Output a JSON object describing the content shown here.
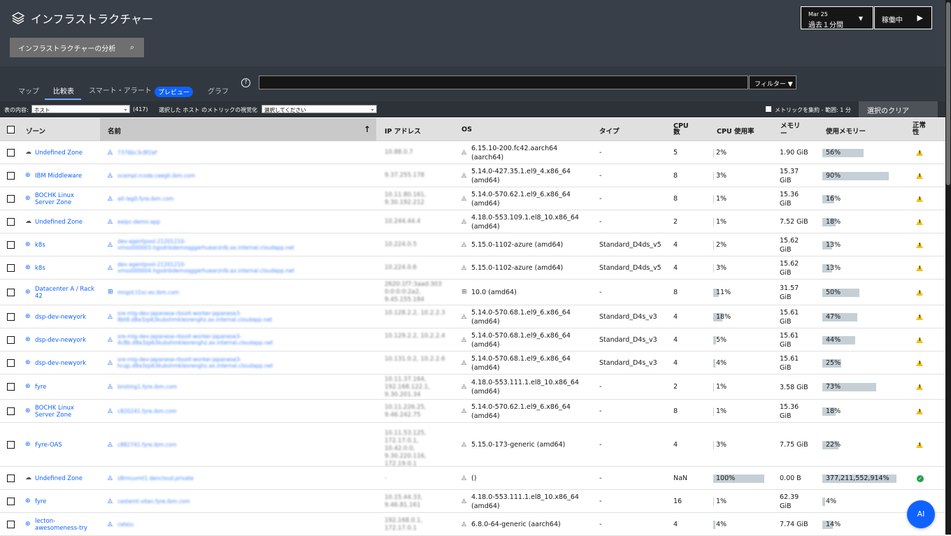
{
  "header": {
    "title": "インフラストラクチャー",
    "time_date": "Mar 25",
    "time_range": "過去１分間",
    "run_label": "稼働中",
    "analyze_label": "インフラストラクチャーの分析"
  },
  "tabs": [
    {
      "label": "マップ",
      "active": false
    },
    {
      "label": "比較表",
      "active": true
    },
    {
      "label": "スマート・アラート",
      "active": false
    },
    {
      "label": "グラフ",
      "active": false
    }
  ],
  "preview_badge": "プレビュー",
  "filter_label": "フィルター",
  "controls": {
    "table_content_label": "表の内容:",
    "table_content_value": "ホスト",
    "count": "(417)",
    "visualize_label": "選択した ホスト のメトリックの視覚化",
    "visualize_value": "選択してください",
    "aggregate_label": "メトリックを集約 - 範囲: 1 分",
    "clear_label": "選択のクリア"
  },
  "columns": [
    "ゾーン",
    "名前",
    "IP アドレス",
    "OS",
    "タイプ",
    "CPU 数",
    "CPU 使用率",
    "メモリー",
    "使用メモリー",
    "正常性"
  ],
  "rows": [
    {
      "zone": "Undefined Zone",
      "zone_icon": "cloud-icon",
      "name": "7376bc3c8f2ef",
      "ip": "10.88.0.7",
      "os": "6.15.10-200.fc42.aarch64 (aarch64)",
      "os_icon": "linux-icon",
      "type": "-",
      "cpus": "5",
      "cpu": "2%",
      "cpu_frac": 0.02,
      "mem": "1.90 GiB",
      "memused": "56%",
      "mem_frac": 0.56,
      "health": "warning"
    },
    {
      "zone": "IBM Middleware",
      "zone_icon": "zone-icon",
      "name": "ocempl.rcode.ceegh.ibm.com",
      "ip": "9.37.255.178",
      "os": "5.14.0-427.35.1.el9_4.x86_64 (amd64)",
      "os_icon": "linux-icon",
      "type": "-",
      "cpus": "8",
      "cpu": "3%",
      "cpu_frac": 0.03,
      "mem": "15.37 GiB",
      "memused": "90%",
      "mem_frac": 0.9,
      "health": "warning"
    },
    {
      "zone": "BOCHK Linux Server Zone",
      "zone_icon": "zone-icon",
      "name": "ait-lag0.fyre.ibm.com",
      "ip": "10.11.80.161, 9.30.192.212",
      "os": "5.14.0-570.62.1.el9_6.x86_64 (amd64)",
      "os_icon": "linux-icon",
      "type": "-",
      "cpus": "8",
      "cpu": "1%",
      "cpu_frac": 0.01,
      "mem": "15.36 GiB",
      "memused": "16%",
      "mem_frac": 0.16,
      "health": "warning"
    },
    {
      "zone": "Undefined Zone",
      "zone_icon": "cloud-icon",
      "name": "eaipc-demo-app",
      "ip": "10.244.44.4",
      "os": "4.18.0-553.109.1.el8_10.x86_64 (amd64)",
      "os_icon": "linux-icon",
      "type": "-",
      "cpus": "2",
      "cpu": "1%",
      "cpu_frac": 0.01,
      "mem": "7.52 GiB",
      "memused": "18%",
      "mem_frac": 0.18,
      "health": "warning"
    },
    {
      "zone": "k8s",
      "zone_icon": "zone-icon",
      "name": "dev-agentpool-21201210-vmss000003.hgsdnbdemoqggerhuearznlb.ax.internal.cloudapp.net",
      "ip": "10.224.0.5",
      "os": "5.15.0-1102-azure (amd64)",
      "os_icon": "linux-icon",
      "type": "Standard_D4ds_v5",
      "cpus": "4",
      "cpu": "2%",
      "cpu_frac": 0.02,
      "mem": "15.62 GiB",
      "memused": "13%",
      "mem_frac": 0.13,
      "health": "warning"
    },
    {
      "zone": "k8s",
      "zone_icon": "zone-icon",
      "name": "dev-agentpool-21201210-vmss000004.hgsdnbdemoqggerhuearznlb.ax.internal.cloudapp.net",
      "ip": "10.224.0.6",
      "os": "5.15.0-1102-azure (amd64)",
      "os_icon": "linux-icon",
      "type": "Standard_D4ds_v5",
      "cpus": "4",
      "cpu": "3%",
      "cpu_frac": 0.03,
      "mem": "15.62 GiB",
      "memused": "13%",
      "mem_frac": 0.13,
      "health": "warning"
    },
    {
      "zone": "Datacenter A / Rack 42",
      "zone_icon": "zone-icon",
      "name": "mngst.t1sc-es.ibm.com",
      "ip": "2620:1f7:3aad:303 0:0:0:0:2a2, 9.45.155.184",
      "os": "10.0 (amd64)",
      "os_icon": "windows-icon",
      "type": "-",
      "cpus": "8",
      "cpu": "11%",
      "cpu_frac": 0.11,
      "mem": "31.57 GiB",
      "memused": "50%",
      "mem_frac": 0.5,
      "health": "warning"
    },
    {
      "zone": "dsp-dev-newyork",
      "zone_icon": "zone-icon",
      "name": "sre-mlg-dev-japanese-rbsoit-worker-japanese3-8bt8.d8a3zp63kubshmklesrenghz.ax.internal.cloudapp.net",
      "ip": "10.128.2.2, 10.2.2.3",
      "os": "5.14.0-570.68.1.el9_6.x86_64 (amd64)",
      "os_icon": "linux-icon",
      "type": "Standard_D4s_v3",
      "cpus": "4",
      "cpu": "18%",
      "cpu_frac": 0.18,
      "mem": "15.61 GiB",
      "memused": "47%",
      "mem_frac": 0.47,
      "health": "warning"
    },
    {
      "zone": "dsp-dev-newyork",
      "zone_icon": "zone-icon",
      "name": "sre-mlg-dev-japanese-rbsoit-worker-japanese3-4c8b.d8a3zp63kubshmklesrenghz.ax.internal.cloudapp.net",
      "ip": "10.129.2.2, 10.2.2.4",
      "os": "5.14.0-570.68.1.el9_6.x86_64 (amd64)",
      "os_icon": "linux-icon",
      "type": "Standard_D4s_v3",
      "cpus": "4",
      "cpu": "5%",
      "cpu_frac": 0.05,
      "mem": "15.61 GiB",
      "memused": "44%",
      "mem_frac": 0.44,
      "health": "warning"
    },
    {
      "zone": "dsp-dev-newyork",
      "zone_icon": "zone-icon",
      "name": "sre-mlg-dev-japanese-rbsoit-worker-japanese3-hcqp.d8a3zp63kubshmklesrenghz.ax.internal.cloudapp.net",
      "ip": "10.131.0.2, 10.2.2.6",
      "os": "5.14.0-570.68.1.el9_6.x86_64 (amd64)",
      "os_icon": "linux-icon",
      "type": "Standard_D4s_v3",
      "cpus": "4",
      "cpu": "4%",
      "cpu_frac": 0.04,
      "mem": "15.61 GiB",
      "memused": "25%",
      "mem_frac": 0.25,
      "health": "warning"
    },
    {
      "zone": "fyre",
      "zone_icon": "zone-icon",
      "name": "bnstmg1.fyre.ibm.com",
      "ip": "10.11.37.164, 192.168.122.1, 9.30.201.34",
      "os": "4.18.0-553.111.1.el8_10.x86_64 (amd64)",
      "os_icon": "linux-icon",
      "type": "-",
      "cpus": "2",
      "cpu": "1%",
      "cpu_frac": 0.01,
      "mem": "3.58 GiB",
      "memused": "73%",
      "mem_frac": 0.73,
      "health": "warning"
    },
    {
      "zone": "BOCHK Linux Server Zone",
      "zone_icon": "zone-icon",
      "name": "c820241.fyre.ibm.com",
      "ip": "10.11.226.25, 9.46.242.75",
      "os": "5.14.0-570.62.1.el9_6.x86_64 (amd64)",
      "os_icon": "linux-icon",
      "type": "-",
      "cpus": "8",
      "cpu": "1%",
      "cpu_frac": 0.01,
      "mem": "15.36 GiB",
      "memused": "18%",
      "mem_frac": 0.18,
      "health": "warning"
    },
    {
      "zone": "Fyre-OAS",
      "zone_icon": "zone-icon",
      "name": "c882741.fyre.ibm.com",
      "ip": "10.11.53.125, 172.17.0.1, 10.42.0.0, 9.30.220.116, 172.19.0.1",
      "os": "5.15.0-173-generic (amd64)",
      "os_icon": "linux-icon",
      "type": "-",
      "cpus": "4",
      "cpu": "3%",
      "cpu_frac": 0.03,
      "mem": "7.75 GiB",
      "memused": "22%",
      "mem_frac": 0.22,
      "health": "warning"
    },
    {
      "zone": "Undefined Zone",
      "zone_icon": "cloud-icon",
      "name": "s8rmuvmt1.dencloud.private",
      "ip": "-",
      "os": "()",
      "os_icon": "linux-icon",
      "type": "-",
      "cpus": "NaN",
      "cpu": "100%",
      "cpu_frac": 1.0,
      "mem": "0.00 B",
      "memused": "377,211,552,914%",
      "mem_frac": 1.0,
      "health": "ok"
    },
    {
      "zone": "fyre",
      "zone_icon": "zone-icon",
      "name": "cestemt-vitan.fyre.ibm.com",
      "ip": "10.15.44.33, 9.46.81.161",
      "os": "4.18.0-553.111.1.el8_10.x86_64 (amd64)",
      "os_icon": "linux-icon",
      "type": "-",
      "cpus": "16",
      "cpu": "1%",
      "cpu_frac": 0.01,
      "mem": "62.39 GiB",
      "memused": "4%",
      "mem_frac": 0.04,
      "health": "none"
    },
    {
      "zone": "lecton-awesomeness-try",
      "zone_icon": "zone-icon",
      "name": "ceteiu",
      "ip": "192.168.0.1, 172.17.0.1",
      "os": "6.8.0-64-generic (aarch64)",
      "os_icon": "linux-icon",
      "type": "-",
      "cpus": "4",
      "cpu": "4%",
      "cpu_frac": 0.04,
      "mem": "7.74 GiB",
      "memused": "14%",
      "mem_frac": 0.14,
      "health": "warning"
    }
  ],
  "fab_label": "AI"
}
